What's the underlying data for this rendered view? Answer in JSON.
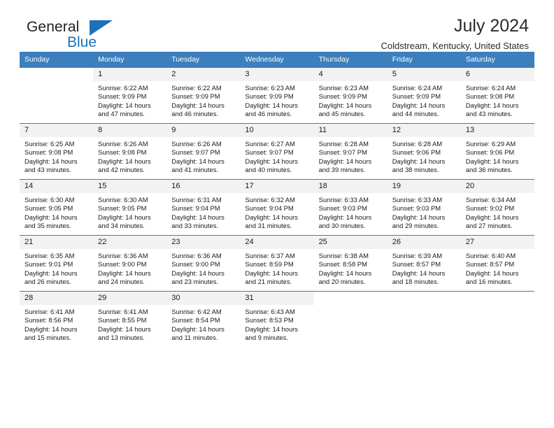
{
  "brand": {
    "name_dark": "General",
    "name_blue": "Blue",
    "accent_color": "#1b72b8"
  },
  "header": {
    "title": "July 2024",
    "subtitle": "Coldstream, Kentucky, United States"
  },
  "theme": {
    "header_row_bg": "#3c7fbd",
    "daynum_bg": "#f2f2f2",
    "grid_line": "#3c7fbd",
    "text": "#1a1a1a"
  },
  "labels": {
    "sunrise": "Sunrise:",
    "sunset": "Sunset:",
    "daylight": "Daylight:"
  },
  "weekdays": [
    "Sunday",
    "Monday",
    "Tuesday",
    "Wednesday",
    "Thursday",
    "Friday",
    "Saturday"
  ],
  "weeks": [
    [
      {
        "day": "",
        "sunrise": "",
        "sunset": "",
        "daylight_line1": "",
        "daylight_line2": ""
      },
      {
        "day": "1",
        "sunrise": "Sunrise: 6:22 AM",
        "sunset": "Sunset: 9:09 PM",
        "daylight_line1": "Daylight: 14 hours",
        "daylight_line2": "and 47 minutes."
      },
      {
        "day": "2",
        "sunrise": "Sunrise: 6:22 AM",
        "sunset": "Sunset: 9:09 PM",
        "daylight_line1": "Daylight: 14 hours",
        "daylight_line2": "and 46 minutes."
      },
      {
        "day": "3",
        "sunrise": "Sunrise: 6:23 AM",
        "sunset": "Sunset: 9:09 PM",
        "daylight_line1": "Daylight: 14 hours",
        "daylight_line2": "and 46 minutes."
      },
      {
        "day": "4",
        "sunrise": "Sunrise: 6:23 AM",
        "sunset": "Sunset: 9:09 PM",
        "daylight_line1": "Daylight: 14 hours",
        "daylight_line2": "and 45 minutes."
      },
      {
        "day": "5",
        "sunrise": "Sunrise: 6:24 AM",
        "sunset": "Sunset: 9:09 PM",
        "daylight_line1": "Daylight: 14 hours",
        "daylight_line2": "and 44 minutes."
      },
      {
        "day": "6",
        "sunrise": "Sunrise: 6:24 AM",
        "sunset": "Sunset: 9:08 PM",
        "daylight_line1": "Daylight: 14 hours",
        "daylight_line2": "and 43 minutes."
      }
    ],
    [
      {
        "day": "7",
        "sunrise": "Sunrise: 6:25 AM",
        "sunset": "Sunset: 9:08 PM",
        "daylight_line1": "Daylight: 14 hours",
        "daylight_line2": "and 43 minutes."
      },
      {
        "day": "8",
        "sunrise": "Sunrise: 6:26 AM",
        "sunset": "Sunset: 9:08 PM",
        "daylight_line1": "Daylight: 14 hours",
        "daylight_line2": "and 42 minutes."
      },
      {
        "day": "9",
        "sunrise": "Sunrise: 6:26 AM",
        "sunset": "Sunset: 9:07 PM",
        "daylight_line1": "Daylight: 14 hours",
        "daylight_line2": "and 41 minutes."
      },
      {
        "day": "10",
        "sunrise": "Sunrise: 6:27 AM",
        "sunset": "Sunset: 9:07 PM",
        "daylight_line1": "Daylight: 14 hours",
        "daylight_line2": "and 40 minutes."
      },
      {
        "day": "11",
        "sunrise": "Sunrise: 6:28 AM",
        "sunset": "Sunset: 9:07 PM",
        "daylight_line1": "Daylight: 14 hours",
        "daylight_line2": "and 39 minutes."
      },
      {
        "day": "12",
        "sunrise": "Sunrise: 6:28 AM",
        "sunset": "Sunset: 9:06 PM",
        "daylight_line1": "Daylight: 14 hours",
        "daylight_line2": "and 38 minutes."
      },
      {
        "day": "13",
        "sunrise": "Sunrise: 6:29 AM",
        "sunset": "Sunset: 9:06 PM",
        "daylight_line1": "Daylight: 14 hours",
        "daylight_line2": "and 36 minutes."
      }
    ],
    [
      {
        "day": "14",
        "sunrise": "Sunrise: 6:30 AM",
        "sunset": "Sunset: 9:05 PM",
        "daylight_line1": "Daylight: 14 hours",
        "daylight_line2": "and 35 minutes."
      },
      {
        "day": "15",
        "sunrise": "Sunrise: 6:30 AM",
        "sunset": "Sunset: 9:05 PM",
        "daylight_line1": "Daylight: 14 hours",
        "daylight_line2": "and 34 minutes."
      },
      {
        "day": "16",
        "sunrise": "Sunrise: 6:31 AM",
        "sunset": "Sunset: 9:04 PM",
        "daylight_line1": "Daylight: 14 hours",
        "daylight_line2": "and 33 minutes."
      },
      {
        "day": "17",
        "sunrise": "Sunrise: 6:32 AM",
        "sunset": "Sunset: 9:04 PM",
        "daylight_line1": "Daylight: 14 hours",
        "daylight_line2": "and 31 minutes."
      },
      {
        "day": "18",
        "sunrise": "Sunrise: 6:33 AM",
        "sunset": "Sunset: 9:03 PM",
        "daylight_line1": "Daylight: 14 hours",
        "daylight_line2": "and 30 minutes."
      },
      {
        "day": "19",
        "sunrise": "Sunrise: 6:33 AM",
        "sunset": "Sunset: 9:03 PM",
        "daylight_line1": "Daylight: 14 hours",
        "daylight_line2": "and 29 minutes."
      },
      {
        "day": "20",
        "sunrise": "Sunrise: 6:34 AM",
        "sunset": "Sunset: 9:02 PM",
        "daylight_line1": "Daylight: 14 hours",
        "daylight_line2": "and 27 minutes."
      }
    ],
    [
      {
        "day": "21",
        "sunrise": "Sunrise: 6:35 AM",
        "sunset": "Sunset: 9:01 PM",
        "daylight_line1": "Daylight: 14 hours",
        "daylight_line2": "and 26 minutes."
      },
      {
        "day": "22",
        "sunrise": "Sunrise: 6:36 AM",
        "sunset": "Sunset: 9:00 PM",
        "daylight_line1": "Daylight: 14 hours",
        "daylight_line2": "and 24 minutes."
      },
      {
        "day": "23",
        "sunrise": "Sunrise: 6:36 AM",
        "sunset": "Sunset: 9:00 PM",
        "daylight_line1": "Daylight: 14 hours",
        "daylight_line2": "and 23 minutes."
      },
      {
        "day": "24",
        "sunrise": "Sunrise: 6:37 AM",
        "sunset": "Sunset: 8:59 PM",
        "daylight_line1": "Daylight: 14 hours",
        "daylight_line2": "and 21 minutes."
      },
      {
        "day": "25",
        "sunrise": "Sunrise: 6:38 AM",
        "sunset": "Sunset: 8:58 PM",
        "daylight_line1": "Daylight: 14 hours",
        "daylight_line2": "and 20 minutes."
      },
      {
        "day": "26",
        "sunrise": "Sunrise: 6:39 AM",
        "sunset": "Sunset: 8:57 PM",
        "daylight_line1": "Daylight: 14 hours",
        "daylight_line2": "and 18 minutes."
      },
      {
        "day": "27",
        "sunrise": "Sunrise: 6:40 AM",
        "sunset": "Sunset: 8:57 PM",
        "daylight_line1": "Daylight: 14 hours",
        "daylight_line2": "and 16 minutes."
      }
    ],
    [
      {
        "day": "28",
        "sunrise": "Sunrise: 6:41 AM",
        "sunset": "Sunset: 8:56 PM",
        "daylight_line1": "Daylight: 14 hours",
        "daylight_line2": "and 15 minutes."
      },
      {
        "day": "29",
        "sunrise": "Sunrise: 6:41 AM",
        "sunset": "Sunset: 8:55 PM",
        "daylight_line1": "Daylight: 14 hours",
        "daylight_line2": "and 13 minutes."
      },
      {
        "day": "30",
        "sunrise": "Sunrise: 6:42 AM",
        "sunset": "Sunset: 8:54 PM",
        "daylight_line1": "Daylight: 14 hours",
        "daylight_line2": "and 11 minutes."
      },
      {
        "day": "31",
        "sunrise": "Sunrise: 6:43 AM",
        "sunset": "Sunset: 8:53 PM",
        "daylight_line1": "Daylight: 14 hours",
        "daylight_line2": "and 9 minutes."
      },
      {
        "day": "",
        "sunrise": "",
        "sunset": "",
        "daylight_line1": "",
        "daylight_line2": ""
      },
      {
        "day": "",
        "sunrise": "",
        "sunset": "",
        "daylight_line1": "",
        "daylight_line2": ""
      },
      {
        "day": "",
        "sunrise": "",
        "sunset": "",
        "daylight_line1": "",
        "daylight_line2": ""
      }
    ]
  ]
}
